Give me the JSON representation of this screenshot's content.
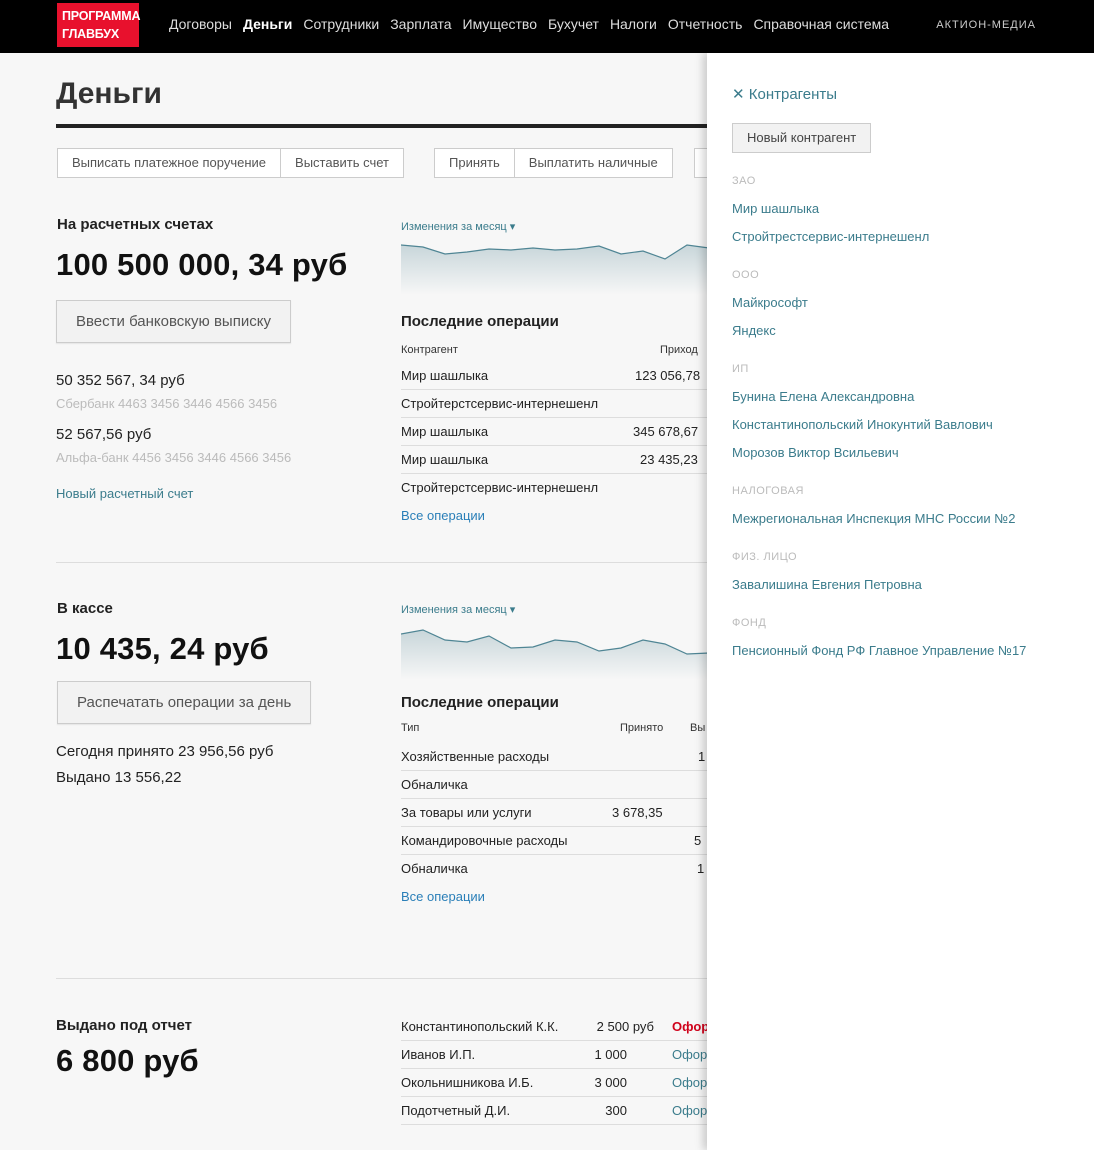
{
  "header": {
    "logo_line1": "ПРОГРАММА",
    "logo_line2": "ГЛАВБУХ",
    "nav": [
      "Договоры",
      "Деньги",
      "Сотрудники",
      "Зарплата",
      "Имущество",
      "Бухучет",
      "Налоги",
      "Отчетность",
      "Справочная система"
    ],
    "active_nav": "Деньги",
    "brand": "АКТИОН-МЕДИА"
  },
  "page": {
    "title": "Деньги",
    "toolbar_group1": [
      "Выписать платежное поручение",
      "Выставить счет"
    ],
    "toolbar_group2": [
      "Принять",
      "Выплатить наличные"
    ]
  },
  "bank": {
    "title": "На расчетных счетах",
    "amount": "100 500 000, 34 руб",
    "button": "Ввести банковскую выписку",
    "accounts": [
      {
        "amount": "50 352 567, 34 руб",
        "bank": "Сбербанк 4463 3456 3446 4566 3456"
      },
      {
        "amount": "52 567,56 руб",
        "bank": "Альфа-банк 4456 3456 3446 4566 3456"
      }
    ],
    "new_account": "Новый расчетный счет",
    "changes": "Изменения за месяц",
    "ops_title": "Последние операции",
    "ops_headers": [
      "Контрагент",
      "Приход"
    ],
    "ops": [
      {
        "name": "Мир шашлыка",
        "income": "123 056,78"
      },
      {
        "name": "Стройтерстсервис-интернешенл",
        "income": ""
      },
      {
        "name": "Мир шашлыка",
        "income": "345 678,67"
      },
      {
        "name": "Мир шашлыка",
        "income": "23 435,23"
      },
      {
        "name": "Стройтерстсервис-интернешенл",
        "income": ""
      }
    ],
    "all_ops": "Все операции"
  },
  "cash": {
    "title": "В кассе",
    "amount": "10 435, 24 руб",
    "button": "Распечатать операции за день",
    "today": "Сегодня принято 23 956,56 руб",
    "issued": "Выдано 13 556,22",
    "changes": "Изменения за месяц",
    "ops_title": "Последние операции",
    "ops_headers": [
      "Тип",
      "Принято",
      "Вы"
    ],
    "ops": [
      {
        "type": "Хозяйственные расходы",
        "received": "",
        "out": "1"
      },
      {
        "type": "Обналичка",
        "received": "",
        "out": ""
      },
      {
        "type": "За товары или услуги",
        "received": "3 678,35",
        "out": ""
      },
      {
        "type": "Командировочные расходы",
        "received": "",
        "out": "5"
      },
      {
        "type": "Обналичка",
        "received": "",
        "out": "1"
      }
    ],
    "all_ops": "Все операции"
  },
  "report": {
    "title": "Выдано под отчет",
    "amount": "6 800 руб",
    "rows": [
      {
        "name": "Константинопольский К.К.",
        "amount": "2 500 руб",
        "status": "Офор"
      },
      {
        "name": "Иванов И.П.",
        "amount": "1 000",
        "status": "Офор"
      },
      {
        "name": "Окольнишникова И.Б.",
        "amount": "3 000",
        "status": "Офор"
      },
      {
        "name": "Подотчетный Д.И.",
        "amount": "300",
        "status": "Офор"
      }
    ]
  },
  "drawer": {
    "close_label": "Контрагенты",
    "new_button": "Новый контрагент",
    "groups": [
      {
        "label": "ЗАО",
        "items": [
          "Мир шашлыка",
          "Стройтрестсервис-интернешенл"
        ]
      },
      {
        "label": "ООО",
        "items": [
          "Майкрософт",
          "Яндекс"
        ]
      },
      {
        "label": "ИП",
        "items": [
          "Бунина Елена Александровна",
          "Константинопольский Инокунтий Вавлович",
          "Морозов Виктор Всильевич"
        ]
      },
      {
        "label": "НАЛОГОВАЯ",
        "items": [
          "Межрегиональная Инспекция МНС России №2"
        ]
      },
      {
        "label": "ФИЗ. ЛИЦО",
        "items": [
          "Завалишина Евгения Петровна"
        ]
      },
      {
        "label": "ФОНД",
        "items": [
          "Пенсионный Фонд РФ Главное Управление №17"
        ]
      }
    ]
  },
  "colors": {
    "brand_red": "#e8112d",
    "link": "#3b7c8c",
    "accent_red": "#d0021b"
  }
}
